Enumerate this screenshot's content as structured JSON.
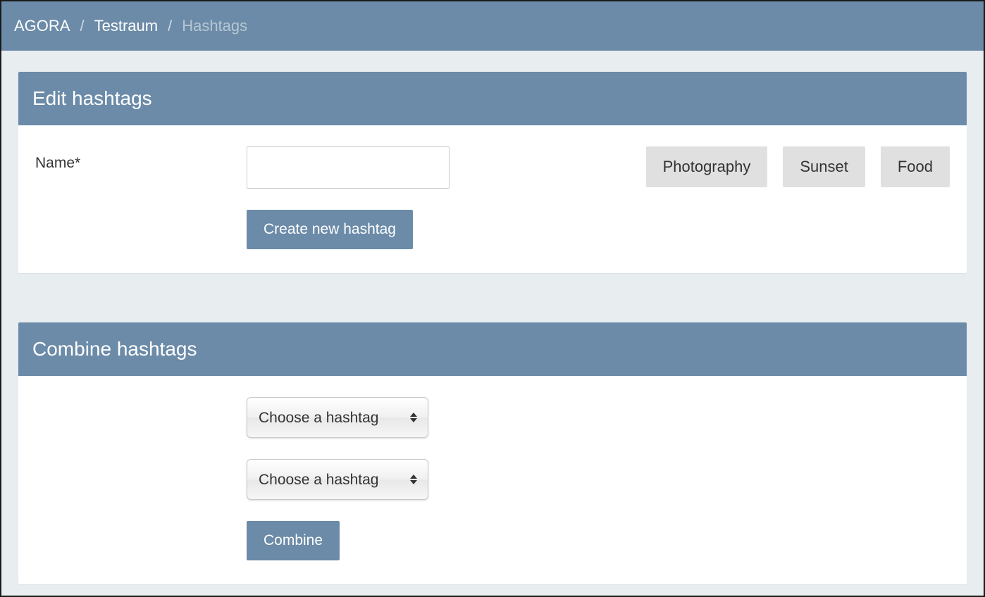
{
  "breadcrumb": {
    "items": [
      {
        "label": "AGORA"
      },
      {
        "label": "Testraum"
      }
    ],
    "current": "Hashtags",
    "separator": "/"
  },
  "panels": {
    "edit": {
      "title": "Edit hashtags",
      "name_label": "Name*",
      "name_value": "",
      "create_button": "Create new hashtag",
      "tags": [
        {
          "label": "Photography"
        },
        {
          "label": "Sunset"
        },
        {
          "label": "Food"
        }
      ]
    },
    "combine": {
      "title": "Combine hashtags",
      "select1_placeholder": "Choose a hashtag",
      "select2_placeholder": "Choose a hashtag",
      "combine_button": "Combine"
    }
  }
}
